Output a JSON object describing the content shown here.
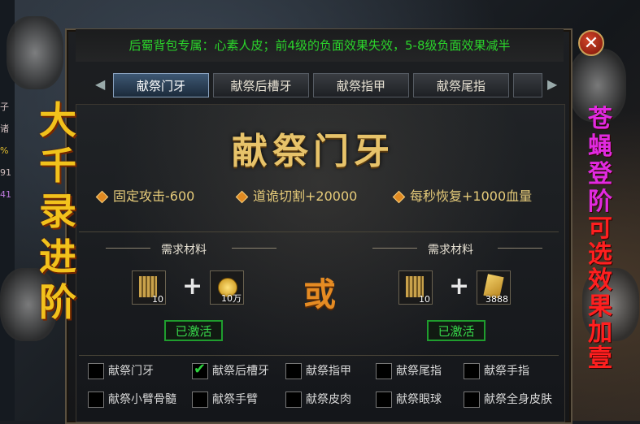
{
  "left_strip": [
    "子",
    "诸",
    "%",
    "91",
    "41"
  ],
  "notice": "后蜀背包专属：心素人皮；前4级的负面效果失效，5-8级负面效果减半",
  "close_label": "✕",
  "tabs": [
    "献祭门牙",
    "献祭后槽牙",
    "献祭指甲",
    "献祭尾指"
  ],
  "title": "献祭门牙",
  "effects": [
    "固定攻击-600",
    "道诡切割+20000",
    "每秒恢复+1000血量"
  ],
  "requirements": {
    "label": "需求材料",
    "left": {
      "item1_qty": "10",
      "item2_qty": "10万",
      "status": "已激活"
    },
    "or": "或",
    "right": {
      "item1_qty": "10",
      "item2_qty": "3888",
      "status": "已激活"
    }
  },
  "checkbox_items": [
    {
      "label": "献祭门牙",
      "checked": false
    },
    {
      "label": "献祭后槽牙",
      "checked": true
    },
    {
      "label": "献祭指甲",
      "checked": false
    },
    {
      "label": "献祭尾指",
      "checked": false
    },
    {
      "label": "献祭手指",
      "checked": false
    },
    {
      "label": "献祭小臂骨髓",
      "checked": false
    },
    {
      "label": "献祭手臂",
      "checked": false
    },
    {
      "label": "献祭皮肉",
      "checked": false
    },
    {
      "label": "献祭眼球",
      "checked": false
    },
    {
      "label": "献祭全身皮肤",
      "checked": false
    }
  ],
  "calligraphy_left": "大千录进阶",
  "calligraphy_right_a": "苍蝇登阶",
  "calligraphy_right_b": "可选效果加壹",
  "colors": {
    "notice": "#2bd42b",
    "title": "#e7c36a",
    "activated": "#37d84a",
    "or": "#e58b23"
  }
}
